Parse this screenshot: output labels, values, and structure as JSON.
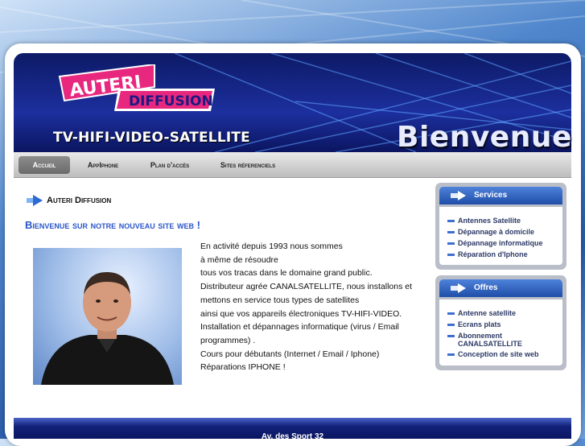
{
  "brand": {
    "name_top": "AUTERI",
    "name_bottom": "DIFFUSION",
    "tagline": "TV-HIFI-VIDEO-SATELLITE"
  },
  "banner": {
    "welcome": "Bienvenue"
  },
  "nav": {
    "items": [
      {
        "label": "Accueil",
        "active": true
      },
      {
        "label": "AppIphone",
        "active": false
      },
      {
        "label": "Plan d'accès",
        "active": false
      },
      {
        "label": "Sites réferenciels",
        "active": false
      }
    ]
  },
  "main": {
    "crumb": "Auteri Diffusion",
    "headline": "Bienvenue sur notre nouveau site web !",
    "description": [
      "En activité depuis 1993 nous sommes",
      "à même de résoudre",
      "tous vos tracas dans le domaine grand public.",
      "Distributeur agrée CANALSATELLITE, nous installons et",
      "mettons en service tous types de satellites",
      "ainsi que vos appareils électroniques TV-HIFI-VIDEO.",
      "Installation et dépannages informatique (virus / Email",
      "programmes) .",
      "Cours pour débutants (Internet / Email / Iphone)",
      "Réparations IPHONE !"
    ]
  },
  "services": {
    "title": "Services",
    "items": [
      "Antennes Satellite",
      "Dépannage à domicile",
      "Dépannage informatique",
      "Réparation d'Iphone"
    ]
  },
  "offres": {
    "title": "Offres",
    "items": [
      "Antenne satellite",
      "Ecrans plats",
      "Abonnement CANALSATELLITE",
      "Conception de site web"
    ]
  },
  "footer": {
    "address": "Av. des Sport 32"
  },
  "colors": {
    "accent": "#2b56c9",
    "banner": "#1c2f9e",
    "logo_pink": "#e8277f"
  }
}
